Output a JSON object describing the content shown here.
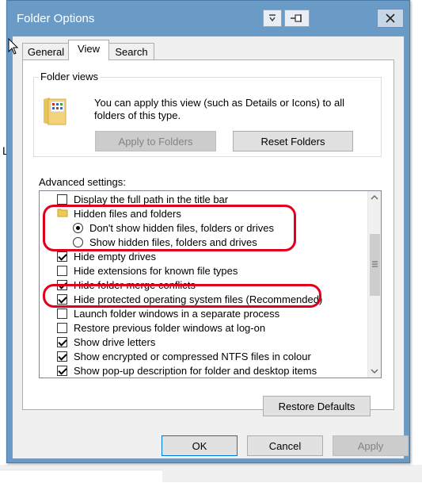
{
  "window": {
    "title": "Folder Options"
  },
  "tabs": [
    {
      "label": "General"
    },
    {
      "label": "View"
    },
    {
      "label": "Search"
    }
  ],
  "folder_views": {
    "group_label": "Folder views",
    "description": "You can apply this view (such as Details or Icons) to all folders of this type.",
    "apply_button": "Apply to Folders",
    "reset_button": "Reset Folders"
  },
  "advanced": {
    "label": "Advanced settings:",
    "items": [
      {
        "type": "checkbox",
        "checked": false,
        "label": "Display the full path in the title bar"
      },
      {
        "type": "folder",
        "label": "Hidden files and folders"
      },
      {
        "type": "radio",
        "checked": true,
        "label": "Don't show hidden files, folders or drives"
      },
      {
        "type": "radio",
        "checked": false,
        "label": "Show hidden files, folders and drives"
      },
      {
        "type": "checkbox",
        "checked": true,
        "label": "Hide empty drives"
      },
      {
        "type": "checkbox",
        "checked": false,
        "label": "Hide extensions for known file types"
      },
      {
        "type": "checkbox",
        "checked": true,
        "label": "Hide folder merge conflicts"
      },
      {
        "type": "checkbox",
        "checked": true,
        "label": "Hide protected operating system files (Recommended)"
      },
      {
        "type": "checkbox",
        "checked": false,
        "label": "Launch folder windows in a separate process"
      },
      {
        "type": "checkbox",
        "checked": false,
        "label": "Restore previous folder windows at log-on"
      },
      {
        "type": "checkbox",
        "checked": true,
        "label": "Show drive letters"
      },
      {
        "type": "checkbox",
        "checked": true,
        "label": "Show encrypted or compressed NTFS files in colour"
      },
      {
        "type": "checkbox",
        "checked": true,
        "label": "Show pop-up description for folder and desktop items"
      }
    ],
    "restore_button": "Restore Defaults"
  },
  "footer": {
    "ok": "OK",
    "cancel": "Cancel",
    "apply": "Apply"
  },
  "background": {
    "letter": "L"
  },
  "colors": {
    "titlebar": "#6a9ac6",
    "highlight": "#e0001b",
    "focus": "#0078d7"
  },
  "icons": [
    "close-icon",
    "pin-icon",
    "folder-icon",
    "cursor-icon"
  ]
}
